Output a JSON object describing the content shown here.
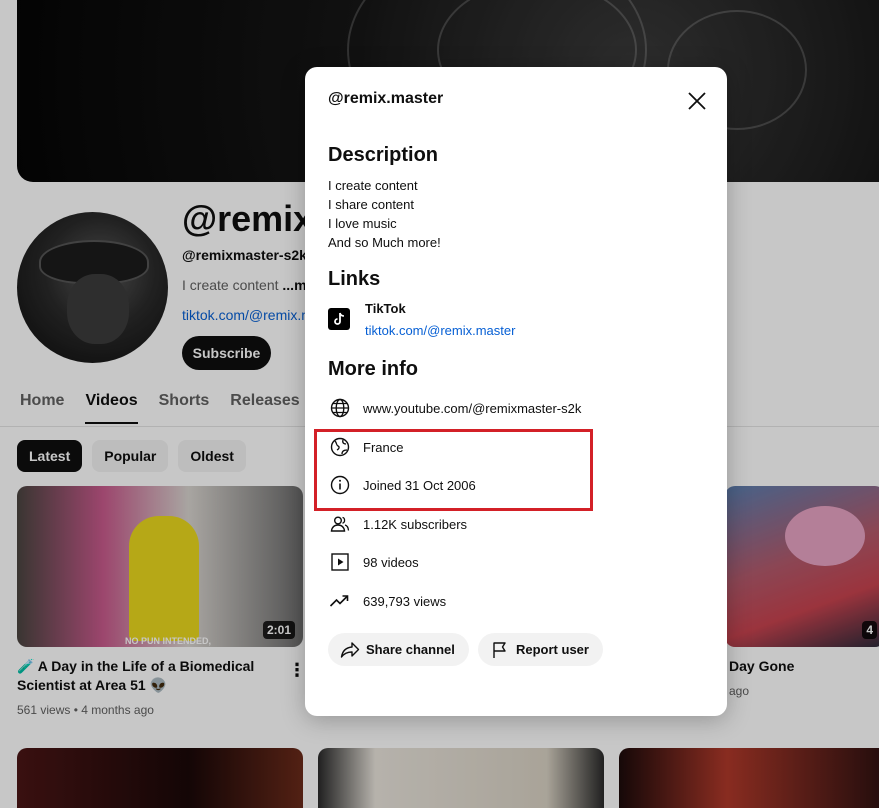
{
  "channel": {
    "title": "@remix.",
    "handle": "@remixmaster-s2k ·",
    "desc_prefix": "I create content ",
    "desc_more": "...mo",
    "link": "tiktok.com/@remix.m",
    "subscribe_label": "Subscribe"
  },
  "tabs": [
    {
      "label": "Home"
    },
    {
      "label": "Videos"
    },
    {
      "label": "Shorts"
    },
    {
      "label": "Releases"
    }
  ],
  "chips": [
    {
      "label": "Latest"
    },
    {
      "label": "Popular"
    },
    {
      "label": "Oldest"
    }
  ],
  "videos": [
    {
      "title": "🧪 A Day in the Life of a Biomedical Scientist at Area 51 👽",
      "meta": "561 views • 4 months ago",
      "duration": "2:01",
      "caption": "NO PUN INTENDED,"
    },
    {
      "title": "Day Gone",
      "meta": "ago",
      "duration": "4"
    }
  ],
  "modal": {
    "title": "@remix.master",
    "description_heading": "Description",
    "description_lines": [
      "I create content",
      "I share content",
      "I love music",
      "And so Much more!"
    ],
    "links_heading": "Links",
    "link": {
      "name": "TikTok",
      "url": "tiktok.com/@remix.master",
      "icon": "tiktok-icon"
    },
    "more_info_heading": "More info",
    "info": [
      {
        "icon": "globe-icon",
        "text": "www.youtube.com/@remixmaster-s2k"
      },
      {
        "icon": "location-globe-icon",
        "text": "France"
      },
      {
        "icon": "info-icon",
        "text": "Joined 31 Oct 2006"
      },
      {
        "icon": "subscribers-icon",
        "text": "1.12K subscribers"
      },
      {
        "icon": "video-play-icon",
        "text": "98 videos"
      },
      {
        "icon": "trending-icon",
        "text": "639,793 views"
      }
    ],
    "share_label": "Share channel",
    "report_label": "Report user"
  },
  "colors": {
    "highlight": "#d32027",
    "link": "#065fd4",
    "chip_active": "#0f0f0f"
  }
}
